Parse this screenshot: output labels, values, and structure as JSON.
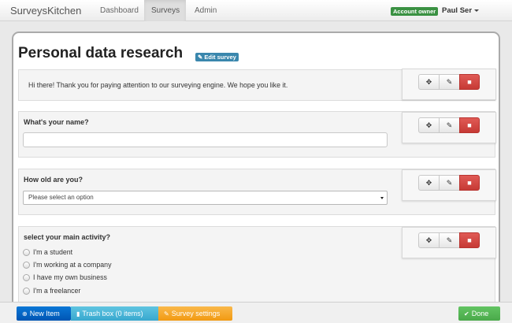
{
  "navbar": {
    "brand": "SurveysKitchen",
    "links": [
      "Dashboard",
      "Surveys",
      "Admin"
    ],
    "active_link": "Surveys",
    "owner_badge": "Account owner",
    "user_name": "Paul Ser"
  },
  "page": {
    "title": "Personal data research",
    "edit_survey_label": "Edit survey"
  },
  "blocks": [
    {
      "type": "text",
      "text": "Hi there! Thank you for paying attention to our surveying engine. We hope you like it."
    },
    {
      "type": "text_input",
      "label": "What's your name?",
      "value": "",
      "placeholder": ""
    },
    {
      "type": "select",
      "label": "How old are you?",
      "selected": "Please select an option"
    },
    {
      "type": "radio",
      "label": "select your main activity?",
      "options": [
        "I'm a student",
        "I'm working at a company",
        "I have my own business",
        "I'm a freelancer"
      ]
    }
  ],
  "tools": {
    "move_icon": "move-icon",
    "edit_icon": "pencil-icon",
    "delete_icon": "trash-icon"
  },
  "bottombar": {
    "new_item": "New Item",
    "trash_box": "Trash box (0 items)",
    "survey_settings": "Survey settings",
    "done": "Done"
  },
  "colors": {
    "owner_badge": "#3a9142",
    "edit_badge": "#3a87ad",
    "delete_button": "#d9534f",
    "new_item_button": "#0065c8",
    "trash_button": "#49b3d8",
    "settings_button": "#f5a623",
    "done_button": "#5cb85c"
  }
}
